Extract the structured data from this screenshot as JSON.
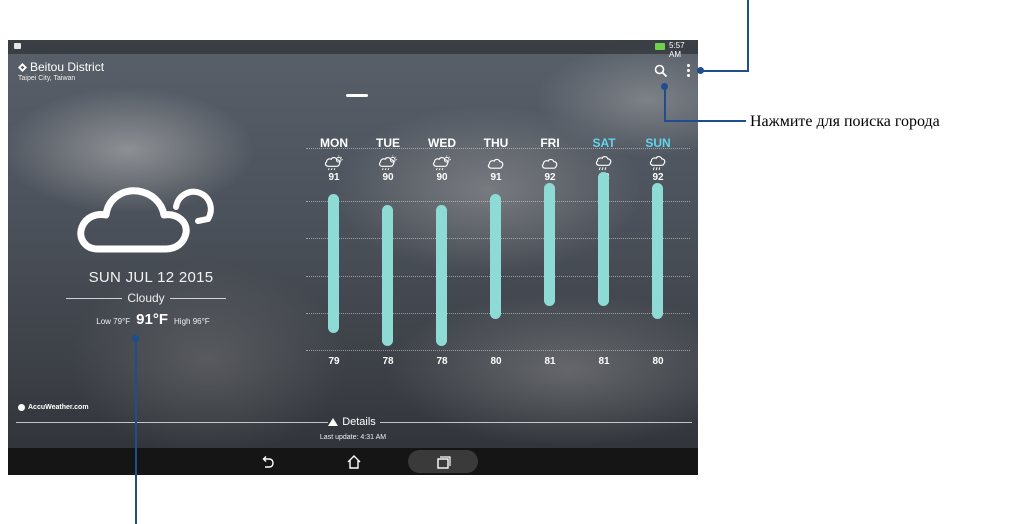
{
  "status_bar": {
    "time": "5:57 AM"
  },
  "location": {
    "name": "Beitou District",
    "region": "Taipei City, Taiwan"
  },
  "current": {
    "date": "SUN JUL 12 2015",
    "condition": "Cloudy",
    "low": "Low 79°F",
    "temp": "91°F",
    "high": "High 96°F",
    "icon": "cloudy-icon"
  },
  "forecast": [
    {
      "day": "MON",
      "high": "91",
      "low": "79",
      "icon": "thunder-rain-icon",
      "weekend": false
    },
    {
      "day": "TUE",
      "high": "90",
      "low": "78",
      "icon": "thunder-rain-icon",
      "weekend": false
    },
    {
      "day": "WED",
      "high": "90",
      "low": "78",
      "icon": "thunder-rain-icon",
      "weekend": false
    },
    {
      "day": "THU",
      "high": "91",
      "low": "80",
      "icon": "cloud-icon",
      "weekend": false
    },
    {
      "day": "FRI",
      "high": "92",
      "low": "81",
      "icon": "cloud-icon",
      "weekend": false
    },
    {
      "day": "SAT",
      "high": "93",
      "low": "81",
      "icon": "cloud-rain-icon",
      "weekend": true
    },
    {
      "day": "SUN",
      "high": "92",
      "low": "80",
      "icon": "cloud-rain-icon",
      "weekend": true
    }
  ],
  "brand": "AccuWeather.com",
  "details": {
    "label": "Details",
    "last_update": "Last update: 4:31 AM"
  },
  "annotation": {
    "search_label": "Нажмите для поиска города"
  },
  "colors": {
    "weekend": "#5fd6ec",
    "bar": "#8edbd5",
    "callout": "#1f4e8c"
  }
}
